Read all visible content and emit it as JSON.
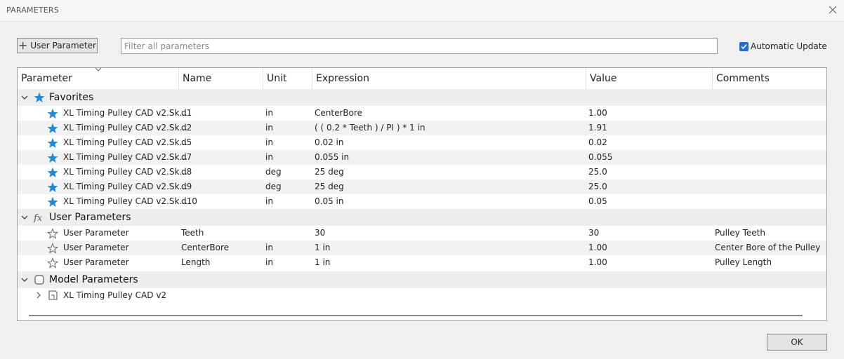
{
  "window": {
    "title": "PARAMETERS"
  },
  "toolbar": {
    "add_label": "User Parameter",
    "filter_placeholder": "Filter all parameters",
    "filter_value": "",
    "auto_update_label": "Automatic Update",
    "auto_update_checked": true
  },
  "columns": [
    "Parameter",
    "Name",
    "Unit",
    "Expression",
    "Value",
    "Comments"
  ],
  "groups": {
    "favorites": {
      "label": "Favorites",
      "rows": [
        {
          "param": "XL Timing Pulley CAD v2.Sk...",
          "name": "d1",
          "unit": "in",
          "expr": "CenterBore",
          "value": "1.00",
          "comment": ""
        },
        {
          "param": "XL Timing Pulley CAD v2.Sk...",
          "name": "d2",
          "unit": "in",
          "expr": "( ( 0.2 * Teeth ) / PI ) * 1 in",
          "value": "1.91",
          "comment": ""
        },
        {
          "param": "XL Timing Pulley CAD v2.Sk...",
          "name": "d5",
          "unit": "in",
          "expr": "0.02 in",
          "value": "0.02",
          "comment": ""
        },
        {
          "param": "XL Timing Pulley CAD v2.Sk...",
          "name": "d7",
          "unit": "in",
          "expr": "0.055 in",
          "value": "0.055",
          "comment": ""
        },
        {
          "param": "XL Timing Pulley CAD v2.Sk...",
          "name": "d8",
          "unit": "deg",
          "expr": "25 deg",
          "value": "25.0",
          "comment": ""
        },
        {
          "param": "XL Timing Pulley CAD v2.Sk...",
          "name": "d9",
          "unit": "deg",
          "expr": "25 deg",
          "value": "25.0",
          "comment": ""
        },
        {
          "param": "XL Timing Pulley CAD v2.Sk...",
          "name": "d10",
          "unit": "in",
          "expr": "0.05 in",
          "value": "0.05",
          "comment": ""
        }
      ]
    },
    "user": {
      "label": "User Parameters",
      "rows": [
        {
          "param": "User Parameter",
          "name": "Teeth",
          "unit": "",
          "expr": "30",
          "value": "30",
          "comment": "Pulley Teeth"
        },
        {
          "param": "User Parameter",
          "name": "CenterBore",
          "unit": "in",
          "expr": "1 in",
          "value": "1.00",
          "comment": "Center Bore of the Pulley"
        },
        {
          "param": "User Parameter",
          "name": "Length",
          "unit": "in",
          "expr": "1 in",
          "value": "1.00",
          "comment": "Pulley Length"
        }
      ]
    },
    "model": {
      "label": "Model Parameters",
      "rows": [
        {
          "param": "XL Timing Pulley CAD v2"
        }
      ]
    }
  },
  "footer": {
    "ok_label": "OK"
  },
  "colors": {
    "accent": "#1e8ad6",
    "checkbox": "#1e6fd1"
  }
}
